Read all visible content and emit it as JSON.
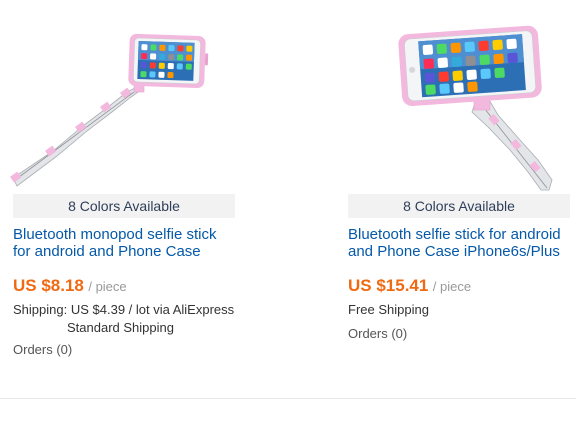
{
  "products": [
    {
      "image_icon": "selfie-stick-with-phone-icon",
      "colors_available": "8 Colors Available",
      "title_line1": "Bluetooth monopod selfie stick",
      "title_line2": "for android and Phone Case",
      "price": "US $8.18",
      "unit": "/ piece",
      "shipping_label": "Shipping:",
      "shipping_value": "US $4.39 / lot via AliExpress",
      "shipping_method": "Standard Shipping",
      "orders": "Orders (0)"
    },
    {
      "image_icon": "selfie-stick-with-phone-icon",
      "colors_available": "8 Colors Available",
      "title_line1": "Bluetooth selfie stick for android",
      "title_line2": "and Phone Case iPhone6s/Plus",
      "price": "US $15.41",
      "unit": "/ piece",
      "shipping": "Free Shipping",
      "orders": "Orders (0)"
    }
  ],
  "colors": {
    "price": "#f06a14",
    "title_link": "#0559a8",
    "case_pink": "#f3b8dd",
    "stick_gray": "#d9dbde"
  }
}
